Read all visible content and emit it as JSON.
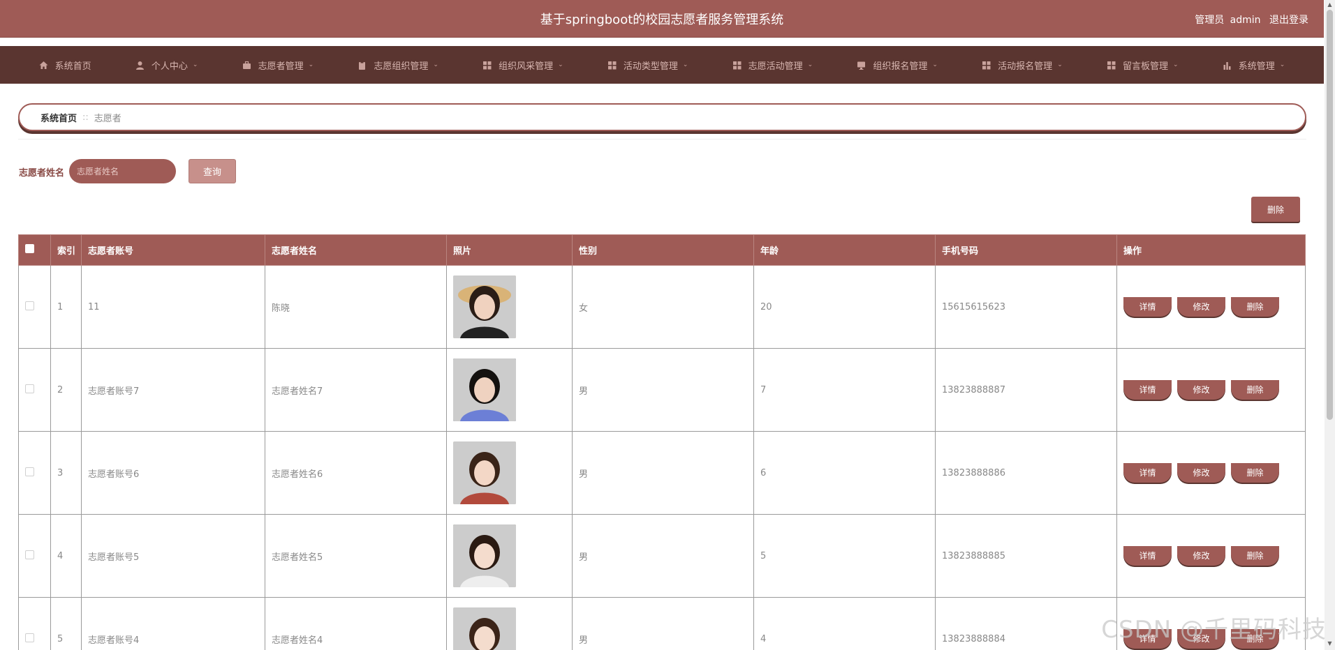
{
  "header": {
    "title": "基于springboot的校园志愿者服务管理系统",
    "user_role": "管理员",
    "username": "admin",
    "logout_label": "退出登录"
  },
  "nav": [
    {
      "label": "系统首页",
      "icon": "home-icon",
      "has_menu": false
    },
    {
      "label": "个人中心",
      "icon": "user-icon",
      "has_menu": true
    },
    {
      "label": "志愿者管理",
      "icon": "briefcase-icon",
      "has_menu": true
    },
    {
      "label": "志愿组织管理",
      "icon": "clipboard-icon",
      "has_menu": true
    },
    {
      "label": "组织风采管理",
      "icon": "grid-icon",
      "has_menu": true
    },
    {
      "label": "活动类型管理",
      "icon": "grid-icon",
      "has_menu": true
    },
    {
      "label": "志愿活动管理",
      "icon": "grid-icon",
      "has_menu": true
    },
    {
      "label": "组织报名管理",
      "icon": "monitor-icon",
      "has_menu": true
    },
    {
      "label": "活动报名管理",
      "icon": "grid-icon",
      "has_menu": true
    },
    {
      "label": "留言板管理",
      "icon": "grid-icon",
      "has_menu": true
    },
    {
      "label": "系统管理",
      "icon": "bar-chart-icon",
      "has_menu": true
    }
  ],
  "breadcrumb": {
    "home": "系统首页",
    "separator": "::",
    "current": "志愿者"
  },
  "search": {
    "label": "志愿者姓名",
    "placeholder": "志愿者姓名",
    "value": "",
    "button": "查询"
  },
  "toolbar": {
    "delete_label": "删除"
  },
  "table": {
    "columns": [
      "索引",
      "志愿者账号",
      "志愿者姓名",
      "照片",
      "性别",
      "年龄",
      "手机号码",
      "操作"
    ],
    "actions": {
      "detail": "详情",
      "edit": "修改",
      "delete": "删除"
    },
    "rows": [
      {
        "index": "1",
        "account": "11",
        "name": "陈晓",
        "gender": "女",
        "age": "20",
        "phone": "15615615623"
      },
      {
        "index": "2",
        "account": "志愿者账号7",
        "name": "志愿者姓名7",
        "gender": "男",
        "age": "7",
        "phone": "13823888887"
      },
      {
        "index": "3",
        "account": "志愿者账号6",
        "name": "志愿者姓名6",
        "gender": "男",
        "age": "6",
        "phone": "13823888886"
      },
      {
        "index": "4",
        "account": "志愿者账号5",
        "name": "志愿者姓名5",
        "gender": "男",
        "age": "5",
        "phone": "13823888885"
      },
      {
        "index": "5",
        "account": "志愿者账号4",
        "name": "志愿者姓名4",
        "gender": "男",
        "age": "4",
        "phone": "13823888884"
      }
    ]
  },
  "watermark": "CSDN @千里码科技",
  "colors": {
    "primary": "#9f5b56",
    "nav": "#5a3530",
    "accent_light": "#c7908b"
  }
}
